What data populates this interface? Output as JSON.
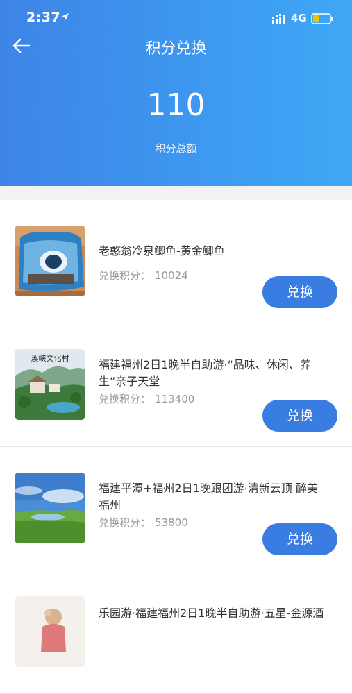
{
  "status_bar": {
    "time": "2:37",
    "network": "4G"
  },
  "header": {
    "title": "积分兑换",
    "points_total": "110",
    "points_total_label": "积分总额"
  },
  "exchange_cost_label": "兑换积分：",
  "exchange_button_label": "兑换",
  "items": [
    {
      "name": "老憨翁冷泉鲫鱼-黄金鲫鱼",
      "cost": "10024",
      "image": "fish-package"
    },
    {
      "name": "福建福州2日1晚半自助游·“品味、休闲、养生”亲子天堂",
      "cost": "113400",
      "image": "resort-village",
      "image_text": "溪峡文化村"
    },
    {
      "name": "福建平潭+福州2日1晚跟团游·清新云顶 醉美福州",
      "cost": "53800",
      "image": "grassland-lake"
    },
    {
      "name": "乐园游·福建福州2日1晚半自助游·五星-金源酒",
      "cost": "",
      "image": "theme-park"
    }
  ],
  "colors": {
    "header_start": "#3d84e6",
    "header_end": "#3ea8f6",
    "button": "#3a7de2"
  }
}
